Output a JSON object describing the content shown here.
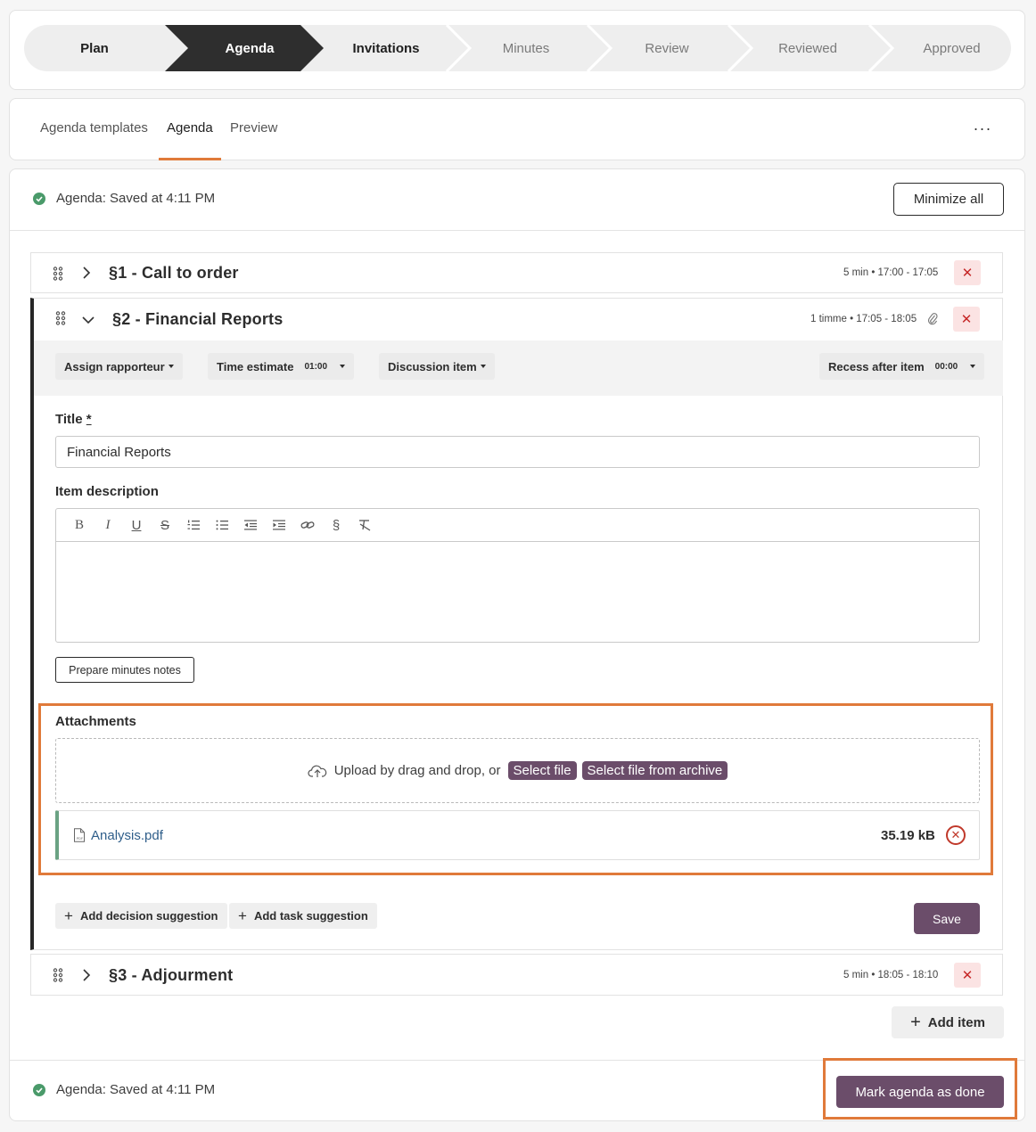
{
  "stepper": {
    "steps": [
      {
        "label": "Plan",
        "state": "done"
      },
      {
        "label": "Agenda",
        "state": "active"
      },
      {
        "label": "Invitations",
        "state": "done"
      },
      {
        "label": "Minutes",
        "state": "future"
      },
      {
        "label": "Review",
        "state": "future"
      },
      {
        "label": "Reviewed",
        "state": "future"
      },
      {
        "label": "Approved",
        "state": "future"
      }
    ]
  },
  "tabs": {
    "items": [
      "Agenda templates",
      "Agenda",
      "Preview"
    ],
    "active": "Agenda",
    "more": "···"
  },
  "status": {
    "top": "Agenda: Saved at 4:11 PM",
    "bottom": "Agenda: Saved at 4:11 PM"
  },
  "minimize_all": "Minimize all",
  "items": [
    {
      "title": "§1 - Call to order",
      "meta": "5 min • 17:00 - 17:05",
      "delete": "✕"
    },
    {
      "title": "§2 - Financial Reports",
      "meta": "1 timme • 17:05 - 18:05",
      "delete": "✕"
    },
    {
      "title": "§3 - Adjourment",
      "meta": "5 min • 18:05 - 18:10",
      "delete": "✕"
    }
  ],
  "options": {
    "assign": "Assign rapporteur",
    "time_estimate": "Time estimate",
    "time_value": "01:00",
    "discussion": "Discussion item",
    "recess": "Recess after item",
    "recess_value": "00:00"
  },
  "form": {
    "title_label": "Title",
    "title_required": "*",
    "title_value": "Financial Reports",
    "description_label": "Item description",
    "toolbar": [
      "B",
      "I",
      "U",
      "S",
      "ordered-list",
      "bullet-list",
      "outdent",
      "indent",
      "link",
      "§",
      "clear-format"
    ],
    "prepare_notes": "Prepare minutes notes"
  },
  "attachments": {
    "label": "Attachments",
    "upload_text": "Upload by drag and drop, or",
    "select_file": "Select file",
    "select_archive": "Select file from archive",
    "file_name": "Analysis.pdf",
    "file_size": "35.19 kB",
    "file_icon_text": "PDF"
  },
  "actions": {
    "add_decision": "Add decision suggestion",
    "add_task": "Add task suggestion",
    "save": "Save",
    "add_item": "Add item",
    "mark_done": "Mark agenda as done"
  },
  "colors": {
    "accent": "#6b4d6a",
    "highlight": "#e07a3a",
    "success": "#4a9a6a",
    "active_step": "#2e2e2e"
  }
}
